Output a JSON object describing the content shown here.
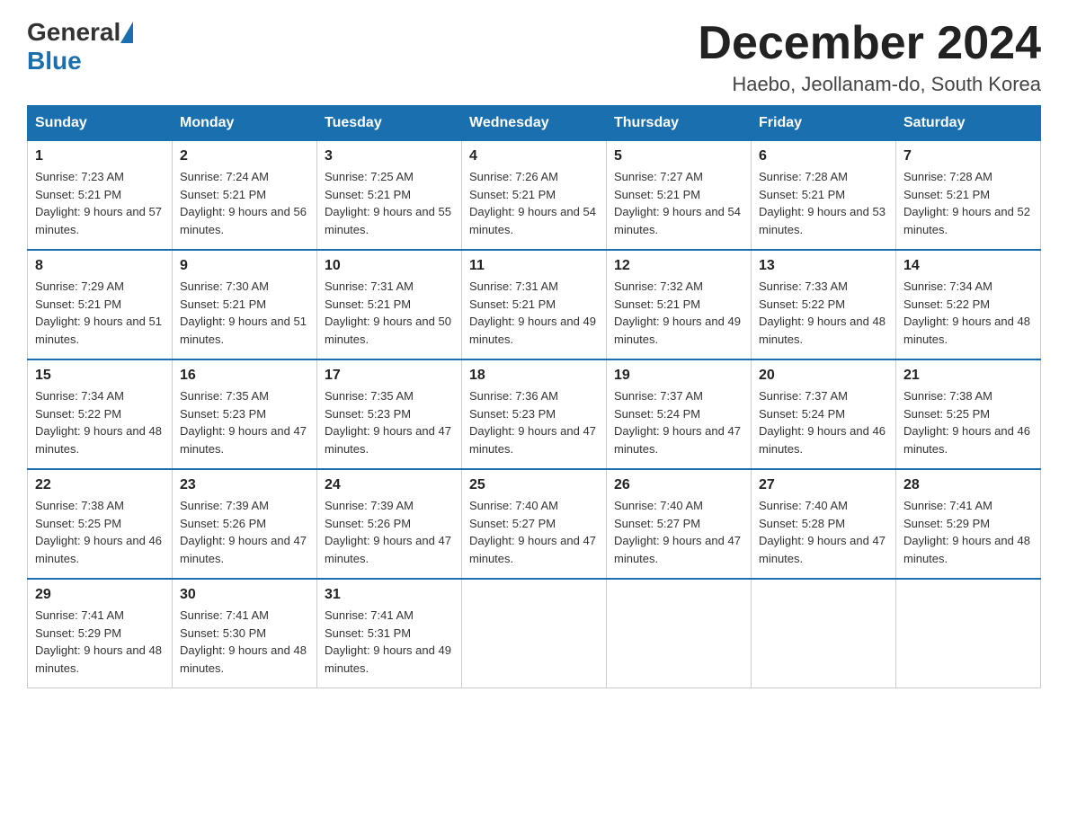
{
  "logo": {
    "general": "General",
    "blue": "Blue"
  },
  "title": "December 2024",
  "location": "Haebo, Jeollanam-do, South Korea",
  "days_of_week": [
    "Sunday",
    "Monday",
    "Tuesday",
    "Wednesday",
    "Thursday",
    "Friday",
    "Saturday"
  ],
  "weeks": [
    [
      {
        "day": "1",
        "sunrise": "7:23 AM",
        "sunset": "5:21 PM",
        "daylight": "9 hours and 57 minutes."
      },
      {
        "day": "2",
        "sunrise": "7:24 AM",
        "sunset": "5:21 PM",
        "daylight": "9 hours and 56 minutes."
      },
      {
        "day": "3",
        "sunrise": "7:25 AM",
        "sunset": "5:21 PM",
        "daylight": "9 hours and 55 minutes."
      },
      {
        "day": "4",
        "sunrise": "7:26 AM",
        "sunset": "5:21 PM",
        "daylight": "9 hours and 54 minutes."
      },
      {
        "day": "5",
        "sunrise": "7:27 AM",
        "sunset": "5:21 PM",
        "daylight": "9 hours and 54 minutes."
      },
      {
        "day": "6",
        "sunrise": "7:28 AM",
        "sunset": "5:21 PM",
        "daylight": "9 hours and 53 minutes."
      },
      {
        "day": "7",
        "sunrise": "7:28 AM",
        "sunset": "5:21 PM",
        "daylight": "9 hours and 52 minutes."
      }
    ],
    [
      {
        "day": "8",
        "sunrise": "7:29 AM",
        "sunset": "5:21 PM",
        "daylight": "9 hours and 51 minutes."
      },
      {
        "day": "9",
        "sunrise": "7:30 AM",
        "sunset": "5:21 PM",
        "daylight": "9 hours and 51 minutes."
      },
      {
        "day": "10",
        "sunrise": "7:31 AM",
        "sunset": "5:21 PM",
        "daylight": "9 hours and 50 minutes."
      },
      {
        "day": "11",
        "sunrise": "7:31 AM",
        "sunset": "5:21 PM",
        "daylight": "9 hours and 49 minutes."
      },
      {
        "day": "12",
        "sunrise": "7:32 AM",
        "sunset": "5:21 PM",
        "daylight": "9 hours and 49 minutes."
      },
      {
        "day": "13",
        "sunrise": "7:33 AM",
        "sunset": "5:22 PM",
        "daylight": "9 hours and 48 minutes."
      },
      {
        "day": "14",
        "sunrise": "7:34 AM",
        "sunset": "5:22 PM",
        "daylight": "9 hours and 48 minutes."
      }
    ],
    [
      {
        "day": "15",
        "sunrise": "7:34 AM",
        "sunset": "5:22 PM",
        "daylight": "9 hours and 48 minutes."
      },
      {
        "day": "16",
        "sunrise": "7:35 AM",
        "sunset": "5:23 PM",
        "daylight": "9 hours and 47 minutes."
      },
      {
        "day": "17",
        "sunrise": "7:35 AM",
        "sunset": "5:23 PM",
        "daylight": "9 hours and 47 minutes."
      },
      {
        "day": "18",
        "sunrise": "7:36 AM",
        "sunset": "5:23 PM",
        "daylight": "9 hours and 47 minutes."
      },
      {
        "day": "19",
        "sunrise": "7:37 AM",
        "sunset": "5:24 PM",
        "daylight": "9 hours and 47 minutes."
      },
      {
        "day": "20",
        "sunrise": "7:37 AM",
        "sunset": "5:24 PM",
        "daylight": "9 hours and 46 minutes."
      },
      {
        "day": "21",
        "sunrise": "7:38 AM",
        "sunset": "5:25 PM",
        "daylight": "9 hours and 46 minutes."
      }
    ],
    [
      {
        "day": "22",
        "sunrise": "7:38 AM",
        "sunset": "5:25 PM",
        "daylight": "9 hours and 46 minutes."
      },
      {
        "day": "23",
        "sunrise": "7:39 AM",
        "sunset": "5:26 PM",
        "daylight": "9 hours and 47 minutes."
      },
      {
        "day": "24",
        "sunrise": "7:39 AM",
        "sunset": "5:26 PM",
        "daylight": "9 hours and 47 minutes."
      },
      {
        "day": "25",
        "sunrise": "7:40 AM",
        "sunset": "5:27 PM",
        "daylight": "9 hours and 47 minutes."
      },
      {
        "day": "26",
        "sunrise": "7:40 AM",
        "sunset": "5:27 PM",
        "daylight": "9 hours and 47 minutes."
      },
      {
        "day": "27",
        "sunrise": "7:40 AM",
        "sunset": "5:28 PM",
        "daylight": "9 hours and 47 minutes."
      },
      {
        "day": "28",
        "sunrise": "7:41 AM",
        "sunset": "5:29 PM",
        "daylight": "9 hours and 48 minutes."
      }
    ],
    [
      {
        "day": "29",
        "sunrise": "7:41 AM",
        "sunset": "5:29 PM",
        "daylight": "9 hours and 48 minutes."
      },
      {
        "day": "30",
        "sunrise": "7:41 AM",
        "sunset": "5:30 PM",
        "daylight": "9 hours and 48 minutes."
      },
      {
        "day": "31",
        "sunrise": "7:41 AM",
        "sunset": "5:31 PM",
        "daylight": "9 hours and 49 minutes."
      },
      null,
      null,
      null,
      null
    ]
  ]
}
